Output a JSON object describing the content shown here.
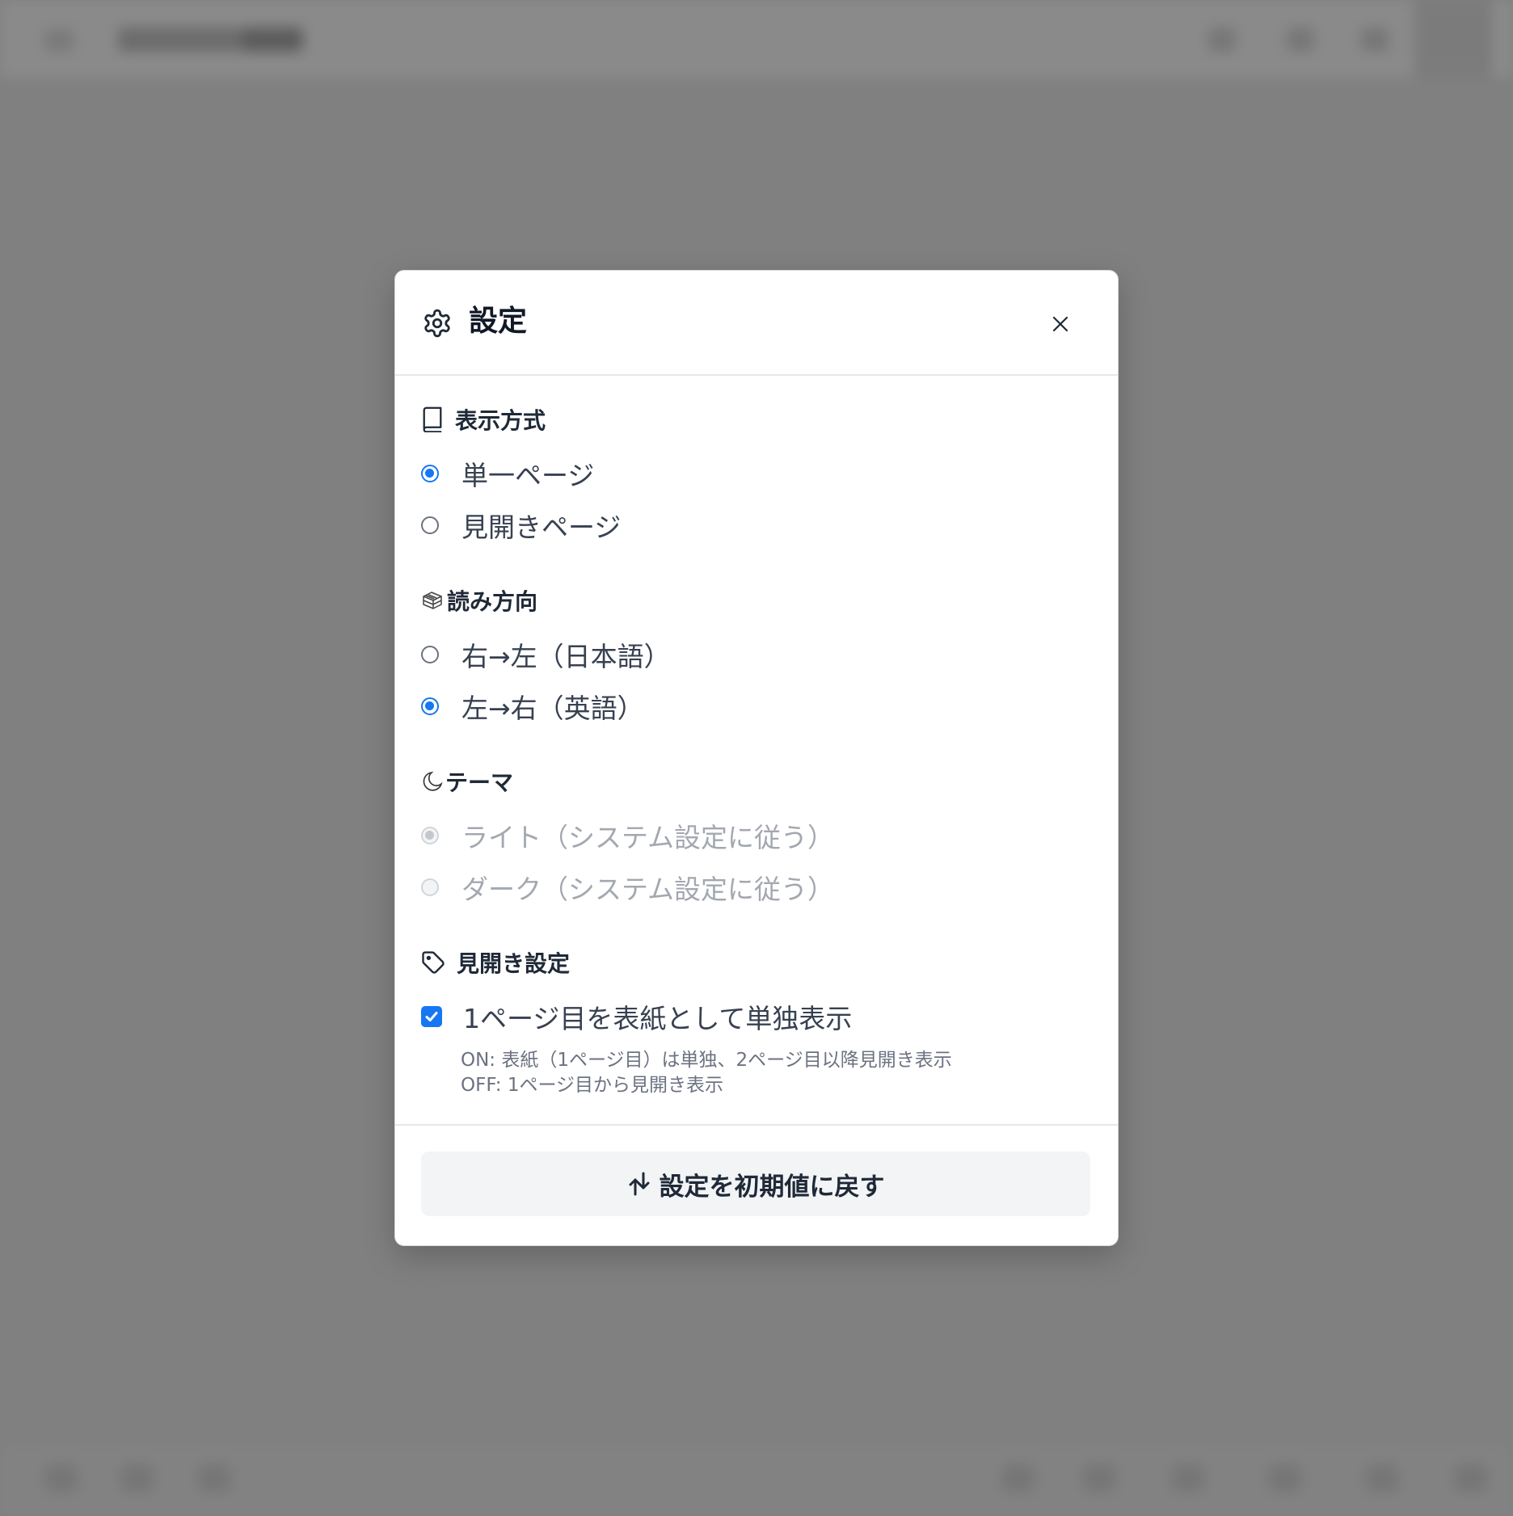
{
  "modal": {
    "title": "設定",
    "header_icon": "gear-icon",
    "close_icon": "close-icon"
  },
  "sections": {
    "display_mode": {
      "title": "表示方式",
      "icon": "book-icon",
      "options": [
        {
          "label": "単一ページ",
          "checked": true
        },
        {
          "label": "見開きページ",
          "checked": false
        }
      ]
    },
    "reading_direction": {
      "title": "読み方向",
      "icon": "books-icon",
      "options": [
        {
          "label": "右→左（日本語）",
          "checked": false
        },
        {
          "label": "左→右（英語）",
          "checked": true
        }
      ]
    },
    "theme": {
      "title": "テーマ",
      "icon": "moon-icon",
      "options": [
        {
          "label": "ライト（システム設定に従う）",
          "checked": true,
          "disabled": true
        },
        {
          "label": "ダーク（システム設定に従う）",
          "checked": false,
          "disabled": true
        }
      ]
    },
    "spread": {
      "title": "見開き設定",
      "icon": "tag-icon",
      "cover_checkbox": {
        "label": "1ページ目を表紙として単独表示",
        "checked": true
      },
      "help_lines": [
        "ON: 表紙（1ページ目）は単独、2ページ目以降見開き表示",
        "OFF: 1ページ目から見開き表示"
      ]
    }
  },
  "reset_button": {
    "label": "設定を初期値に戻す",
    "icon": "reset-arrows-icon"
  },
  "colors": {
    "accent": "#1677f3",
    "overlay": "#808080",
    "modal_bg": "#ffffff",
    "button_bg": "#f3f4f6"
  }
}
